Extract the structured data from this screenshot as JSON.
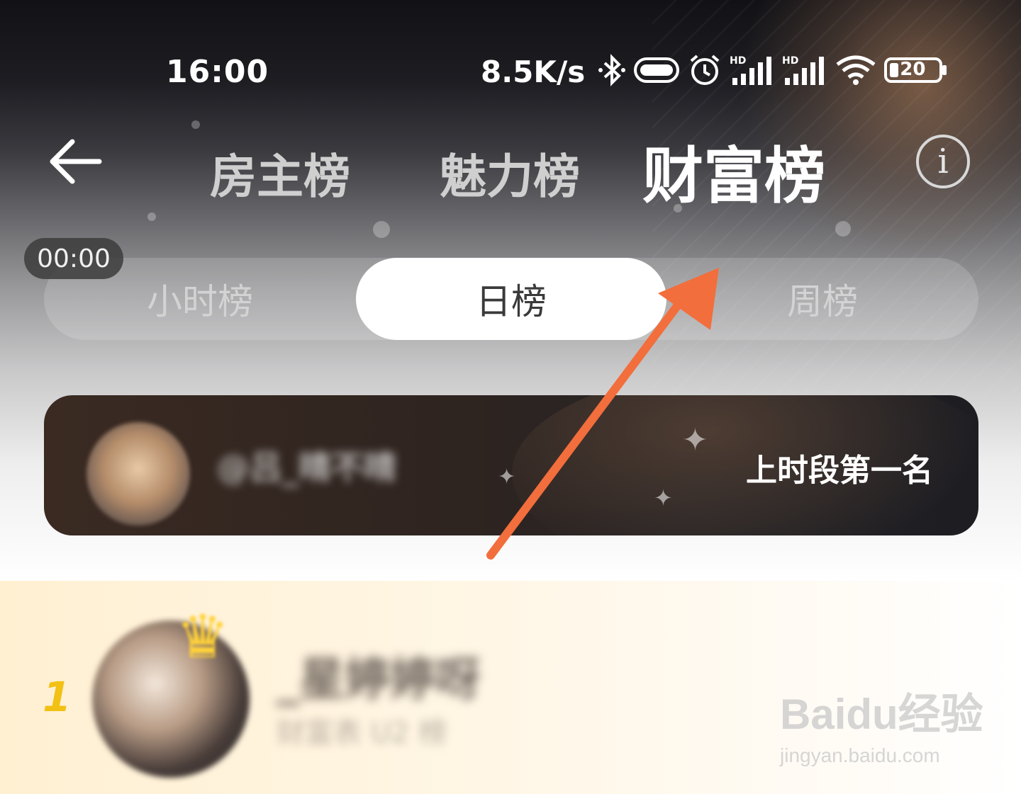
{
  "status_bar": {
    "time": "16:00",
    "net_speed": "8.5K/s",
    "battery": "20",
    "icons": [
      "bluetooth-icon",
      "vpn-icon",
      "alarm-icon",
      "hd-signal-icon",
      "hd-signal-icon",
      "wifi-icon",
      "battery-icon"
    ]
  },
  "header": {
    "tabs": [
      {
        "label": "房主榜",
        "active": false
      },
      {
        "label": "魅力榜",
        "active": false
      },
      {
        "label": "财富榜",
        "active": true
      }
    ],
    "info_label": "i"
  },
  "segment": {
    "countdown": "00:00",
    "items": [
      {
        "label": "小时榜",
        "active": false
      },
      {
        "label": "日榜",
        "active": true
      },
      {
        "label": "周榜",
        "active": false
      }
    ]
  },
  "prev_top": {
    "name": "@吕_晴不晴",
    "label": "上时段第一名"
  },
  "ranking": [
    {
      "rank": "1",
      "name": "_星婷婷呀",
      "sub": "财富表 U2 榜"
    }
  ],
  "watermark": {
    "logo": "Baidu经验",
    "url": "jingyan.baidu.com"
  },
  "colors": {
    "accent_arrow": "#f26e3c",
    "rank_gold": "#f2c114",
    "active_tab_text": "#ffffff"
  }
}
